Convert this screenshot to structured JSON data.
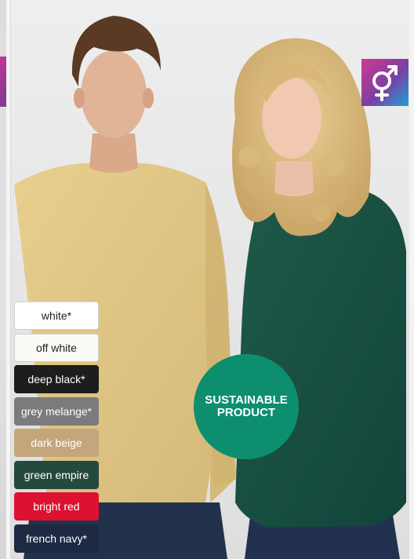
{
  "swatches": [
    {
      "label": "white*",
      "bg": "#ffffff",
      "fg": "#222222",
      "border": "#d0d0d0"
    },
    {
      "label": "off white",
      "bg": "#fbfaf6",
      "fg": "#222222",
      "border": "#d0d0d0"
    },
    {
      "label": "deep black*",
      "bg": "#1d1d1b",
      "fg": "#ffffff",
      "border": "#1d1d1b"
    },
    {
      "label": "grey melange*",
      "bg": "#7b7a7d",
      "fg": "#ffffff",
      "border": "#7b7a7d"
    },
    {
      "label": "dark beige",
      "bg": "#c3a67c",
      "fg": "#ffffff",
      "border": "#c3a67c"
    },
    {
      "label": "green empire",
      "bg": "#244a3e",
      "fg": "#ffffff",
      "border": "#244a3e"
    },
    {
      "label": "bright red",
      "bg": "#dc1230",
      "fg": "#ffffff",
      "border": "#dc1230"
    },
    {
      "label": "french navy*",
      "bg": "#1e2a44",
      "fg": "#ffffff",
      "border": "#1e2a44"
    }
  ],
  "badge": {
    "line1": "SUSTAINABLE",
    "line2": "PRODUCT",
    "color": "#0d8f6f"
  },
  "icons": {
    "gender": "unisex-gender-icon"
  },
  "colors": {
    "gender_badge_start": "#d23a8f",
    "gender_badge_end": "#1aa3d8"
  }
}
